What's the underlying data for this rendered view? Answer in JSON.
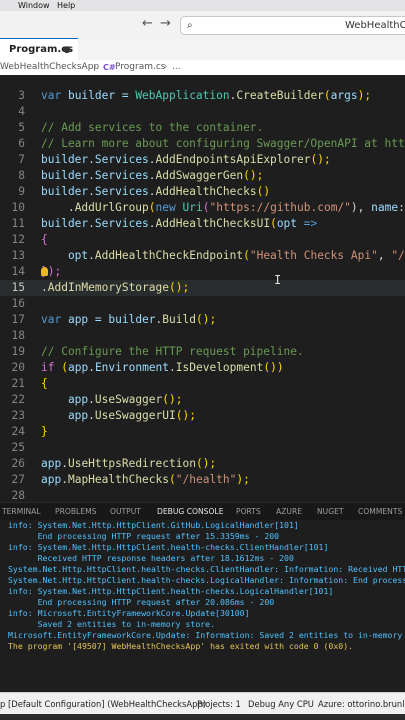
{
  "menubar": {
    "window_label": "Window",
    "help_label": "Help"
  },
  "titlebar": {
    "search_text": "WebHealthChecksApp"
  },
  "tab": {
    "label": "Program.cs"
  },
  "breadcrumb": {
    "project": "WebHealthChecksApp",
    "file": "Program.cs",
    "ellipsis": "..."
  },
  "editor": {
    "current_line": 15,
    "lines": [
      {
        "n": "3"
      },
      {
        "n": "4"
      },
      {
        "n": "5"
      },
      {
        "n": "6"
      },
      {
        "n": "7"
      },
      {
        "n": "8"
      },
      {
        "n": "9"
      },
      {
        "n": "10"
      },
      {
        "n": "11"
      },
      {
        "n": "12"
      },
      {
        "n": "13"
      },
      {
        "n": "14"
      },
      {
        "n": "15"
      },
      {
        "n": "16"
      },
      {
        "n": "17"
      },
      {
        "n": "18"
      },
      {
        "n": "19"
      },
      {
        "n": "20"
      },
      {
        "n": "21"
      },
      {
        "n": "22"
      },
      {
        "n": "23"
      },
      {
        "n": "24"
      },
      {
        "n": "25"
      },
      {
        "n": "26"
      },
      {
        "n": "27"
      },
      {
        "n": "28"
      }
    ]
  },
  "code": {
    "l3": [
      "var",
      " builder = ",
      "WebApplication",
      ".",
      "CreateBuilder",
      "(",
      "args",
      ");"
    ],
    "l5": "// Add services to the container.",
    "l6": "// Learn more about configuring Swagger/OpenAPI at https://",
    "l7": [
      "builder",
      ".",
      "Services",
      ".",
      "AddEndpointsApiExplorer",
      "();"
    ],
    "l8": [
      "builder",
      ".",
      "Services",
      ".",
      "AddSwaggerGen",
      "();"
    ],
    "l9": [
      "builder",
      ".",
      "Services",
      ".",
      "AddHealthChecks",
      "()"
    ],
    "l10": [
      "    .",
      "AddUrlGroup",
      "(",
      "new",
      " ",
      "Uri",
      "(",
      "\"https://github.com/\"",
      "), ",
      "name",
      ": ",
      "\"G"
    ],
    "l11": [
      "builder",
      ".",
      "Services",
      ".",
      "AddHealthChecksUI",
      "(",
      "opt",
      " =>"
    ],
    "l12": "{",
    "l13": [
      "    opt",
      ".",
      "AddHealthCheckEndpoint",
      "(",
      "\"Health Checks Api\"",
      ", ",
      "\"/hea"
    ],
    "l14": "});",
    "l15": [
      ".",
      "AddInMemoryStorage",
      "();"
    ],
    "l17": [
      "var",
      " app = ",
      "builder",
      ".",
      "Build",
      "();"
    ],
    "l19": "// Configure the HTTP request pipeline.",
    "l20": [
      "if",
      " (",
      "app",
      ".",
      "Environment",
      ".",
      "IsDevelopment",
      "())"
    ],
    "l21": "{",
    "l22": [
      "    app",
      ".",
      "UseSwagger",
      "();"
    ],
    "l23": [
      "    app",
      ".",
      "UseSwaggerUI",
      "();"
    ],
    "l24": "}",
    "l26": [
      "app",
      ".",
      "UseHttpsRedirection",
      "();"
    ],
    "l27": [
      "app",
      ".",
      "MapHealthChecks",
      "(",
      "\"/health\"",
      ");"
    ]
  },
  "panel_tabs": [
    "TERMINAL",
    "PROBLEMS",
    "OUTPUT",
    "DEBUG CONSOLE",
    "PORTS",
    "AZURE",
    "NUGET",
    "COMMENTS"
  ],
  "console_lines": [
    "info: System.Net.Http.HttpClient.GitHub.LogicalHandler[101]",
    "      End processing HTTP request after 15.3359ms - 200",
    "info: System.Net.Http.HttpClient.health-checks.ClientHandler[101]",
    "      Received HTTP response headers after 18.1612ms - 200",
    "System.Net.Http.HttpClient.health-checks.ClientHandler: Information: Received HTTP",
    "System.Net.Http.HttpClient.health-checks.LogicalHandler: Information: End process",
    "info: System.Net.Http.HttpClient.health-checks.LogicalHandler[101]",
    "      End processing HTTP request after 20.086ms - 200",
    "info: Microsoft.EntityFrameworkCore.Update[30100]",
    "      Saved 2 entities to in-memory store.",
    "Microsoft.EntityFrameworkCore.Update: Information: Saved 2 entities to in-memory st",
    "The program '[49507] WebHealthChecksApp' has exited with code 0 (0x0)."
  ],
  "statusbar": {
    "config": "p [Default Configuration] (WebHealthChecksApp)",
    "projects": "Projects: 1",
    "debug": "Debug Any CPU",
    "azure": "Azure: ottorino.brunl@..."
  },
  "colors": {
    "editor_bg": "#1e1e1e",
    "keyword": "#569cd6",
    "method": "#dcdcaa",
    "string": "#ce9178",
    "comment": "#6a9955",
    "console_info": "#4fc1ff",
    "console_exit": "#e0c35a"
  }
}
